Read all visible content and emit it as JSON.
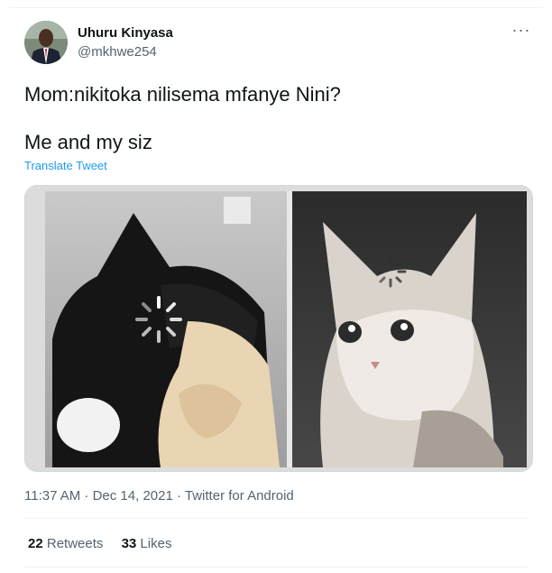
{
  "tweet": {
    "author": {
      "name": "Uhuru Kinyasa",
      "handle": "@mkhwe254"
    },
    "text_lines": [
      "Mom:nikitoka nilisema mfanye Nini?",
      "Me and my siz"
    ],
    "translate_label": "Translate Tweet",
    "more_icon": "more-horizontal-icon",
    "media_description_icon": "meme-image",
    "timestamp": "11:37 AM · Dec 14, 2021 · ",
    "source": "Twitter for Android",
    "retweets": {
      "count": "22",
      "label": "Retweets"
    },
    "likes": {
      "count": "33",
      "label": "Likes"
    }
  },
  "colors": {
    "link": "#1d9bf0",
    "secondary_text": "#536471",
    "primary_text": "#0f1419"
  }
}
